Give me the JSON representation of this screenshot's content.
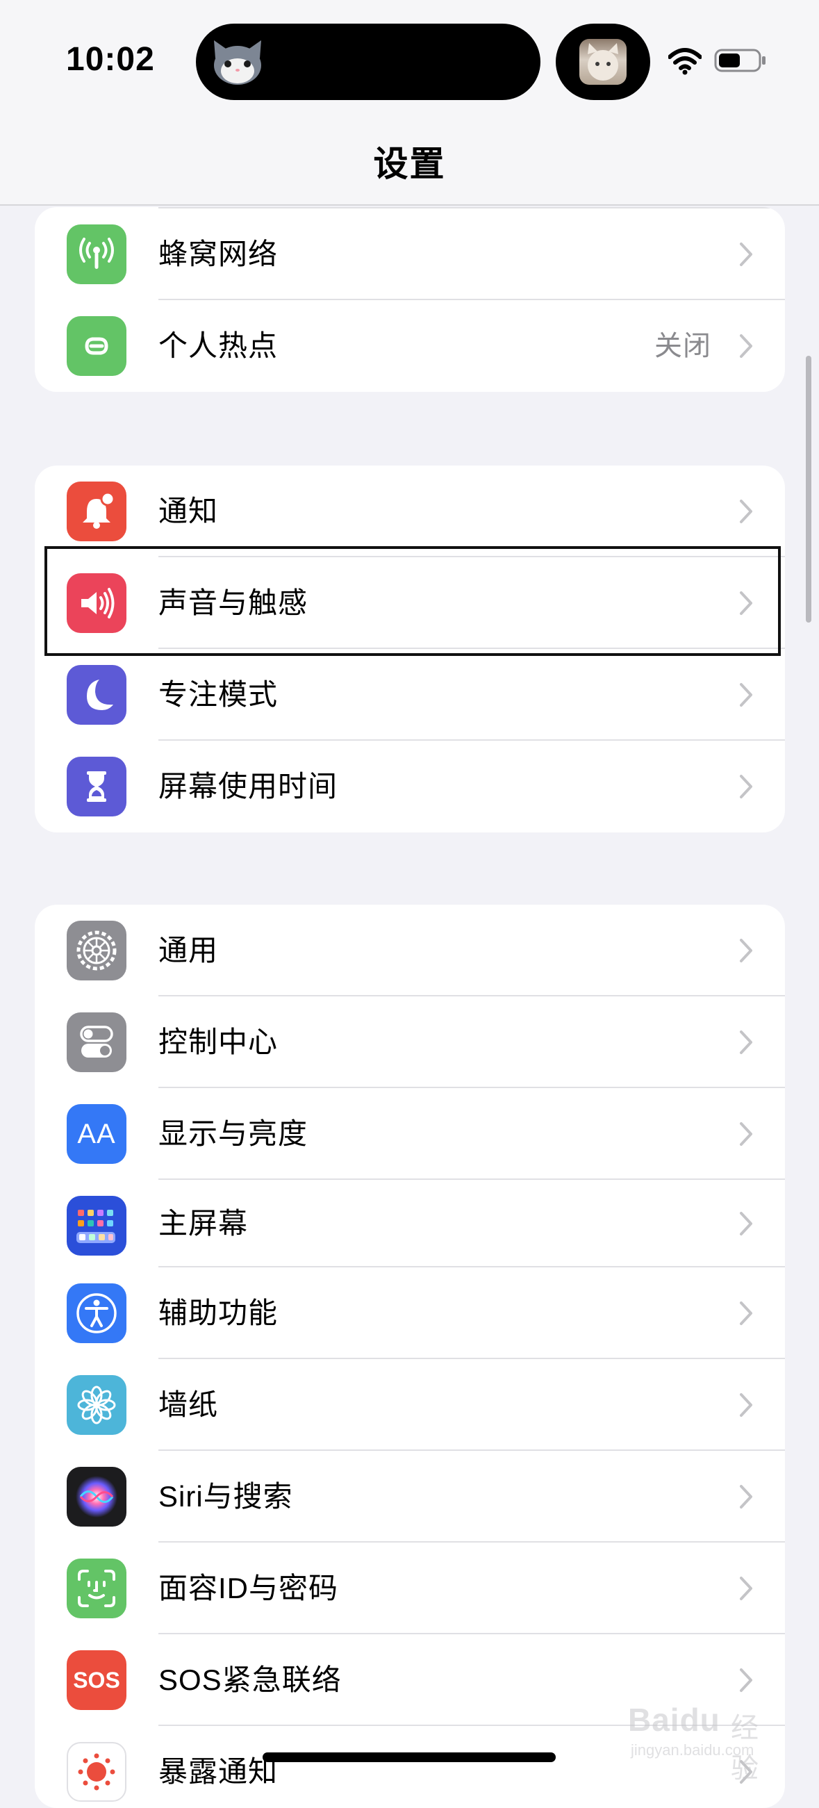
{
  "status_bar": {
    "time": "10:02",
    "wifi_icon": "wifi-icon",
    "battery_icon": "battery-icon"
  },
  "header": {
    "title": "设置"
  },
  "groups": [
    {
      "items": [
        {
          "label": "蜂窝网络",
          "icon": "cellular-icon",
          "color": "#63c466"
        },
        {
          "label": "个人热点",
          "value": "关闭",
          "icon": "hotspot-icon",
          "color": "#63c466"
        }
      ]
    },
    {
      "items": [
        {
          "label": "通知",
          "icon": "notification-icon",
          "color": "#eb4d3d"
        },
        {
          "label": "声音与触感",
          "icon": "speaker-icon",
          "color": "#eb445a"
        },
        {
          "label": "专注模式",
          "icon": "moon-icon",
          "color": "#5d5ad6"
        },
        {
          "label": "屏幕使用时间",
          "icon": "hourglass-icon",
          "color": "#5d5ad6"
        }
      ]
    },
    {
      "items": [
        {
          "label": "通用",
          "icon": "gear-icon",
          "color": "#8e8e93"
        },
        {
          "label": "控制中心",
          "icon": "toggles-icon",
          "color": "#8e8e93"
        },
        {
          "label": "显示与亮度",
          "icon": "text-size-icon",
          "icon_text": "AA",
          "color": "#3478f6"
        },
        {
          "label": "主屏幕",
          "icon": "home-grid-icon",
          "color": "#2b4fd9"
        },
        {
          "label": "辅助功能",
          "icon": "accessibility-icon",
          "color": "#3478f6"
        },
        {
          "label": "墙纸",
          "icon": "flower-icon",
          "color": "#4db5d9"
        },
        {
          "label": "Siri与搜索",
          "icon": "siri-icon",
          "color": "#1c1c1e"
        },
        {
          "label": "面容ID与密码",
          "icon": "faceid-icon",
          "color": "#63c466"
        },
        {
          "label": "SOS紧急联络",
          "icon": "sos-icon",
          "icon_text": "SOS",
          "color": "#eb4d3d"
        },
        {
          "label": "暴露通知",
          "icon": "exposure-icon",
          "color": "#ffffff"
        }
      ]
    }
  ],
  "watermark": {
    "brand": "Baidu",
    "cn": "经验",
    "sub": "jingyan.baidu.com"
  }
}
